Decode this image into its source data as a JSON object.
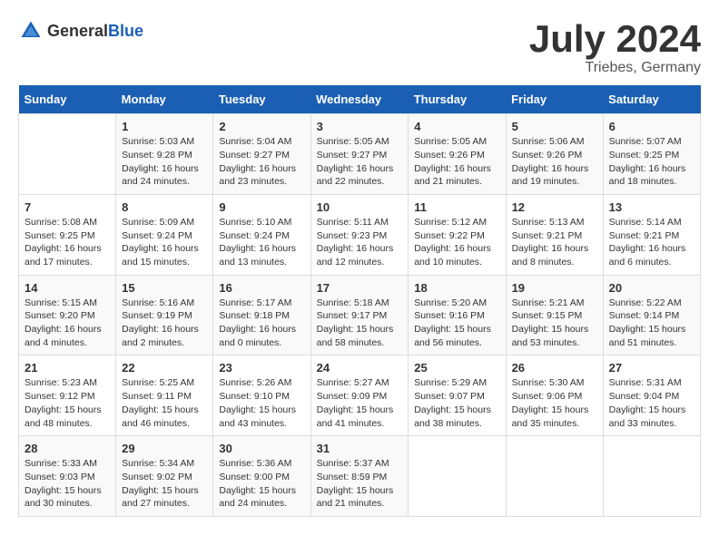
{
  "header": {
    "logo_general": "General",
    "logo_blue": "Blue",
    "title": "July 2024",
    "subtitle": "Triebes, Germany"
  },
  "calendar": {
    "days_of_week": [
      "Sunday",
      "Monday",
      "Tuesday",
      "Wednesday",
      "Thursday",
      "Friday",
      "Saturday"
    ],
    "weeks": [
      [
        {
          "day": "",
          "info": ""
        },
        {
          "day": "1",
          "info": "Sunrise: 5:03 AM\nSunset: 9:28 PM\nDaylight: 16 hours\nand 24 minutes."
        },
        {
          "day": "2",
          "info": "Sunrise: 5:04 AM\nSunset: 9:27 PM\nDaylight: 16 hours\nand 23 minutes."
        },
        {
          "day": "3",
          "info": "Sunrise: 5:05 AM\nSunset: 9:27 PM\nDaylight: 16 hours\nand 22 minutes."
        },
        {
          "day": "4",
          "info": "Sunrise: 5:05 AM\nSunset: 9:26 PM\nDaylight: 16 hours\nand 21 minutes."
        },
        {
          "day": "5",
          "info": "Sunrise: 5:06 AM\nSunset: 9:26 PM\nDaylight: 16 hours\nand 19 minutes."
        },
        {
          "day": "6",
          "info": "Sunrise: 5:07 AM\nSunset: 9:25 PM\nDaylight: 16 hours\nand 18 minutes."
        }
      ],
      [
        {
          "day": "7",
          "info": "Sunrise: 5:08 AM\nSunset: 9:25 PM\nDaylight: 16 hours\nand 17 minutes."
        },
        {
          "day": "8",
          "info": "Sunrise: 5:09 AM\nSunset: 9:24 PM\nDaylight: 16 hours\nand 15 minutes."
        },
        {
          "day": "9",
          "info": "Sunrise: 5:10 AM\nSunset: 9:24 PM\nDaylight: 16 hours\nand 13 minutes."
        },
        {
          "day": "10",
          "info": "Sunrise: 5:11 AM\nSunset: 9:23 PM\nDaylight: 16 hours\nand 12 minutes."
        },
        {
          "day": "11",
          "info": "Sunrise: 5:12 AM\nSunset: 9:22 PM\nDaylight: 16 hours\nand 10 minutes."
        },
        {
          "day": "12",
          "info": "Sunrise: 5:13 AM\nSunset: 9:21 PM\nDaylight: 16 hours\nand 8 minutes."
        },
        {
          "day": "13",
          "info": "Sunrise: 5:14 AM\nSunset: 9:21 PM\nDaylight: 16 hours\nand 6 minutes."
        }
      ],
      [
        {
          "day": "14",
          "info": "Sunrise: 5:15 AM\nSunset: 9:20 PM\nDaylight: 16 hours\nand 4 minutes."
        },
        {
          "day": "15",
          "info": "Sunrise: 5:16 AM\nSunset: 9:19 PM\nDaylight: 16 hours\nand 2 minutes."
        },
        {
          "day": "16",
          "info": "Sunrise: 5:17 AM\nSunset: 9:18 PM\nDaylight: 16 hours\nand 0 minutes."
        },
        {
          "day": "17",
          "info": "Sunrise: 5:18 AM\nSunset: 9:17 PM\nDaylight: 15 hours\nand 58 minutes."
        },
        {
          "day": "18",
          "info": "Sunrise: 5:20 AM\nSunset: 9:16 PM\nDaylight: 15 hours\nand 56 minutes."
        },
        {
          "day": "19",
          "info": "Sunrise: 5:21 AM\nSunset: 9:15 PM\nDaylight: 15 hours\nand 53 minutes."
        },
        {
          "day": "20",
          "info": "Sunrise: 5:22 AM\nSunset: 9:14 PM\nDaylight: 15 hours\nand 51 minutes."
        }
      ],
      [
        {
          "day": "21",
          "info": "Sunrise: 5:23 AM\nSunset: 9:12 PM\nDaylight: 15 hours\nand 48 minutes."
        },
        {
          "day": "22",
          "info": "Sunrise: 5:25 AM\nSunset: 9:11 PM\nDaylight: 15 hours\nand 46 minutes."
        },
        {
          "day": "23",
          "info": "Sunrise: 5:26 AM\nSunset: 9:10 PM\nDaylight: 15 hours\nand 43 minutes."
        },
        {
          "day": "24",
          "info": "Sunrise: 5:27 AM\nSunset: 9:09 PM\nDaylight: 15 hours\nand 41 minutes."
        },
        {
          "day": "25",
          "info": "Sunrise: 5:29 AM\nSunset: 9:07 PM\nDaylight: 15 hours\nand 38 minutes."
        },
        {
          "day": "26",
          "info": "Sunrise: 5:30 AM\nSunset: 9:06 PM\nDaylight: 15 hours\nand 35 minutes."
        },
        {
          "day": "27",
          "info": "Sunrise: 5:31 AM\nSunset: 9:04 PM\nDaylight: 15 hours\nand 33 minutes."
        }
      ],
      [
        {
          "day": "28",
          "info": "Sunrise: 5:33 AM\nSunset: 9:03 PM\nDaylight: 15 hours\nand 30 minutes."
        },
        {
          "day": "29",
          "info": "Sunrise: 5:34 AM\nSunset: 9:02 PM\nDaylight: 15 hours\nand 27 minutes."
        },
        {
          "day": "30",
          "info": "Sunrise: 5:36 AM\nSunset: 9:00 PM\nDaylight: 15 hours\nand 24 minutes."
        },
        {
          "day": "31",
          "info": "Sunrise: 5:37 AM\nSunset: 8:59 PM\nDaylight: 15 hours\nand 21 minutes."
        },
        {
          "day": "",
          "info": ""
        },
        {
          "day": "",
          "info": ""
        },
        {
          "day": "",
          "info": ""
        }
      ]
    ]
  }
}
